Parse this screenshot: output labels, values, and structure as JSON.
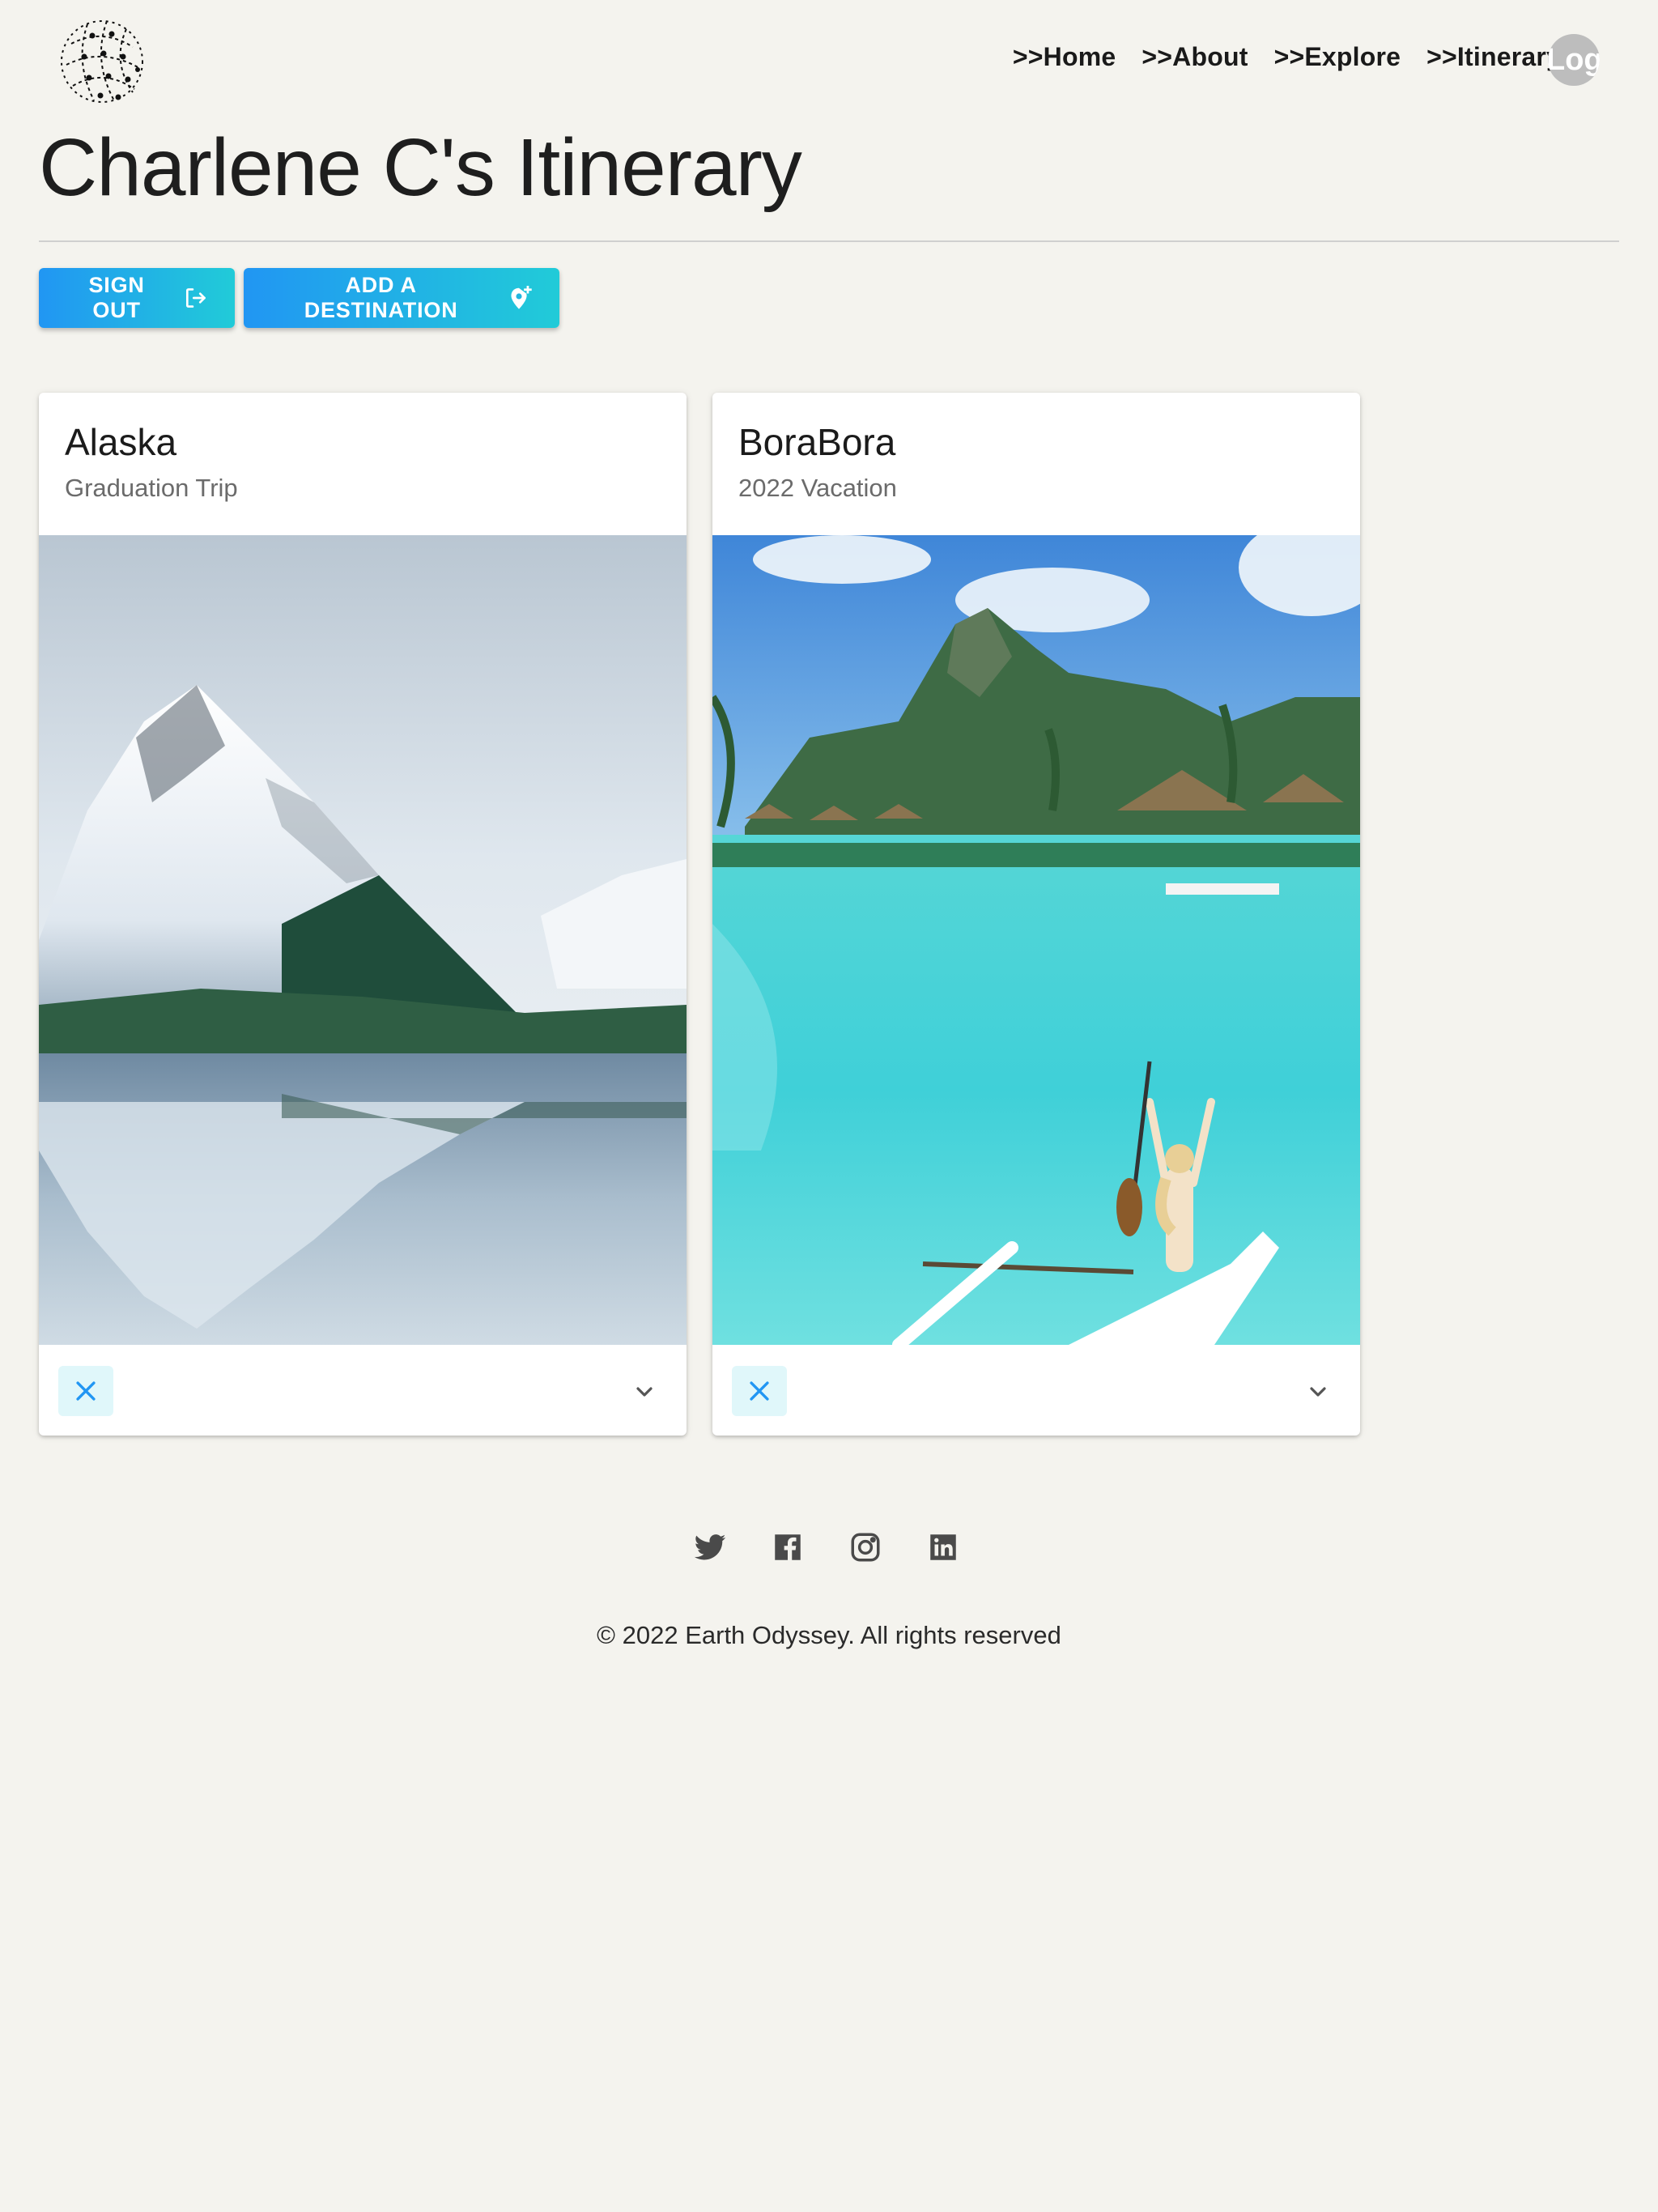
{
  "header": {
    "nav": [
      {
        "label": ">>Home"
      },
      {
        "label": ">>About"
      },
      {
        "label": ">>Explore"
      },
      {
        "label": ">>Itinerary"
      }
    ],
    "avatar_text": "Log"
  },
  "page": {
    "title": "Charlene C's Itinerary"
  },
  "actions": {
    "sign_out": "SIGN OUT",
    "add_destination": "ADD A DESTINATION"
  },
  "destinations": [
    {
      "title": "Alaska",
      "subtitle": "Graduation Trip",
      "image": "snowy-mountain-lake-photo"
    },
    {
      "title": "BoraBora",
      "subtitle": "2022 Vacation",
      "image": "tropical-lagoon-paddleboard-photo"
    }
  ],
  "footer": {
    "social": [
      "twitter-icon",
      "facebook-icon",
      "instagram-icon",
      "linkedin-icon"
    ],
    "copyright": "© 2022 Earth Odyssey. All rights reserved"
  },
  "colors": {
    "background": "#f4f3ee",
    "button_gradient_start": "#2196f3",
    "button_gradient_end": "#21cbd8",
    "remove_button_bg": "#e0f7fa",
    "remove_icon": "#2196f3"
  }
}
